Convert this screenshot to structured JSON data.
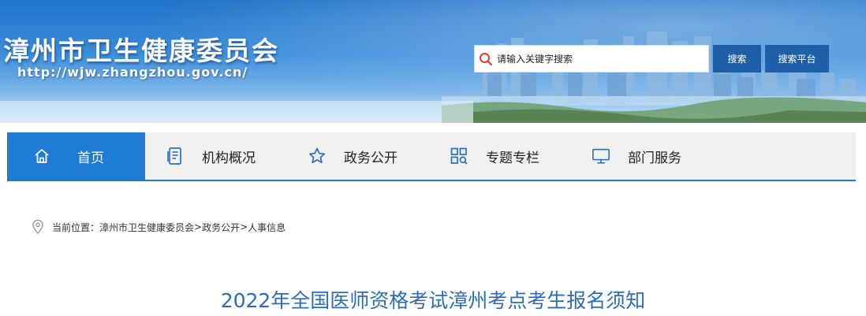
{
  "header": {
    "site_title": "漳州市卫生健康委员会",
    "site_url": "http://wjw.zhangzhou.gov.cn/"
  },
  "search": {
    "placeholder": "请输入关键字搜索",
    "value": "",
    "search_button": "搜索",
    "platform_button": "搜索平台"
  },
  "nav": {
    "items": [
      {
        "label": "首页",
        "icon": "home-icon",
        "active": true
      },
      {
        "label": "机构概况",
        "icon": "document-icon",
        "active": false
      },
      {
        "label": "政务公开",
        "icon": "star-icon",
        "active": false
      },
      {
        "label": "专题专栏",
        "icon": "grid-search-icon",
        "active": false
      },
      {
        "label": "部门服务",
        "icon": "monitor-icon",
        "active": false
      }
    ]
  },
  "breadcrumb": {
    "prefix": "当前位置：",
    "items": [
      "漳州市卫生健康委员会",
      "政务公开",
      "人事信息"
    ],
    "separator": ">"
  },
  "article": {
    "title": "2022年全国医师资格考试漳州考点考生报名须知"
  },
  "colors": {
    "accent": "#1d7bd4",
    "button": "#1f5fa8",
    "title_text": "#2b6db8",
    "nav_bg": "#f0f0f0"
  }
}
